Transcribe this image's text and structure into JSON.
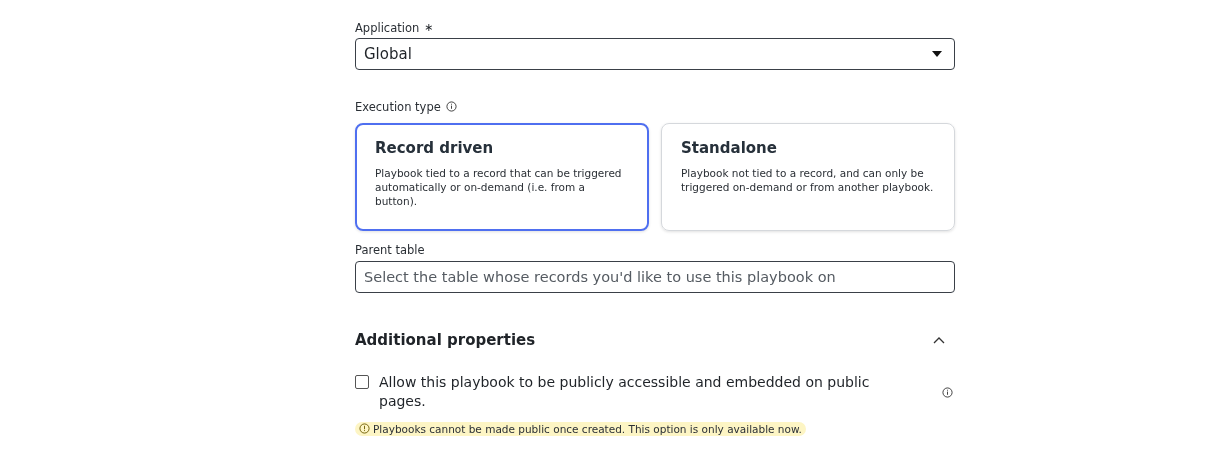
{
  "application": {
    "label": "Application",
    "required_mark": "∗",
    "value": "Global"
  },
  "execution_type": {
    "label": "Execution type",
    "options": [
      {
        "title": "Record driven",
        "description": "Playbook tied to a record that can be triggered automatically or on-demand (i.e. from a button).",
        "selected": true
      },
      {
        "title": "Standalone",
        "description": "Playbook not tied to a record, and can only be triggered on-demand or from another playbook.",
        "selected": false
      }
    ]
  },
  "parent_table": {
    "label": "Parent table",
    "placeholder": "Select the table whose records you'd like to use this playbook on"
  },
  "additional_properties": {
    "title": "Additional properties",
    "expanded": true,
    "public_access": {
      "label": "Allow this playbook to be publicly accessible and embedded on public pages.",
      "checked": false,
      "warning": "Playbooks cannot be made public once created. This option is only available now."
    }
  }
}
